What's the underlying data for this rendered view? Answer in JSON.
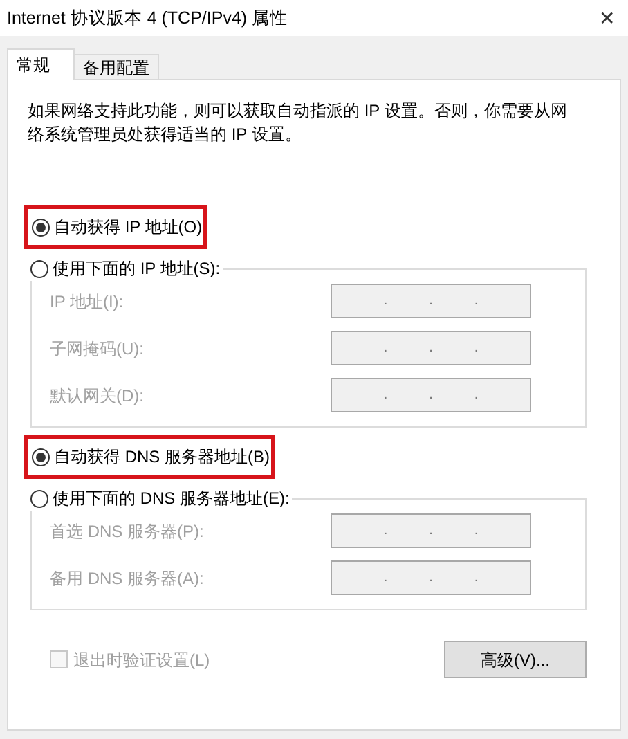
{
  "window": {
    "title": "Internet 协议版本 4 (TCP/IPv4) 属性",
    "close": "✕"
  },
  "tabs": [
    {
      "label": "常规",
      "selected": true
    },
    {
      "label": "备用配置",
      "selected": false
    }
  ],
  "description": "如果网络支持此功能，则可以获取自动指派的 IP 设置。否则，你需要从网络系统管理员处获得适当的 IP 设置。",
  "sections": [
    {
      "auto": {
        "label": "自动获得 IP 地址(O)",
        "selected": true,
        "highlighted": true
      },
      "manual": {
        "label": "使用下面的 IP 地址(S):",
        "selected": false
      },
      "fields": [
        {
          "label": "IP 地址(I):",
          "disabled": true,
          "dots": [
            ".",
            ".",
            "."
          ]
        },
        {
          "label": "子网掩码(U):",
          "disabled": true,
          "dots": [
            ".",
            ".",
            "."
          ]
        },
        {
          "label": "默认网关(D):",
          "disabled": true,
          "dots": [
            ".",
            ".",
            "."
          ]
        }
      ]
    },
    {
      "auto": {
        "label": "自动获得 DNS 服务器地址(B)",
        "selected": true,
        "highlighted": true
      },
      "manual": {
        "label": "使用下面的 DNS 服务器地址(E):",
        "selected": false
      },
      "fields": [
        {
          "label": "首选 DNS 服务器(P):",
          "disabled": true,
          "dots": [
            ".",
            ".",
            "."
          ]
        },
        {
          "label": "备用 DNS 服务器(A):",
          "disabled": true,
          "dots": [
            ".",
            ".",
            "."
          ]
        }
      ]
    }
  ],
  "validate": {
    "label": "退出时验证设置(L)",
    "checked": false,
    "disabled": true
  },
  "advanced_button": "高级(V)..."
}
